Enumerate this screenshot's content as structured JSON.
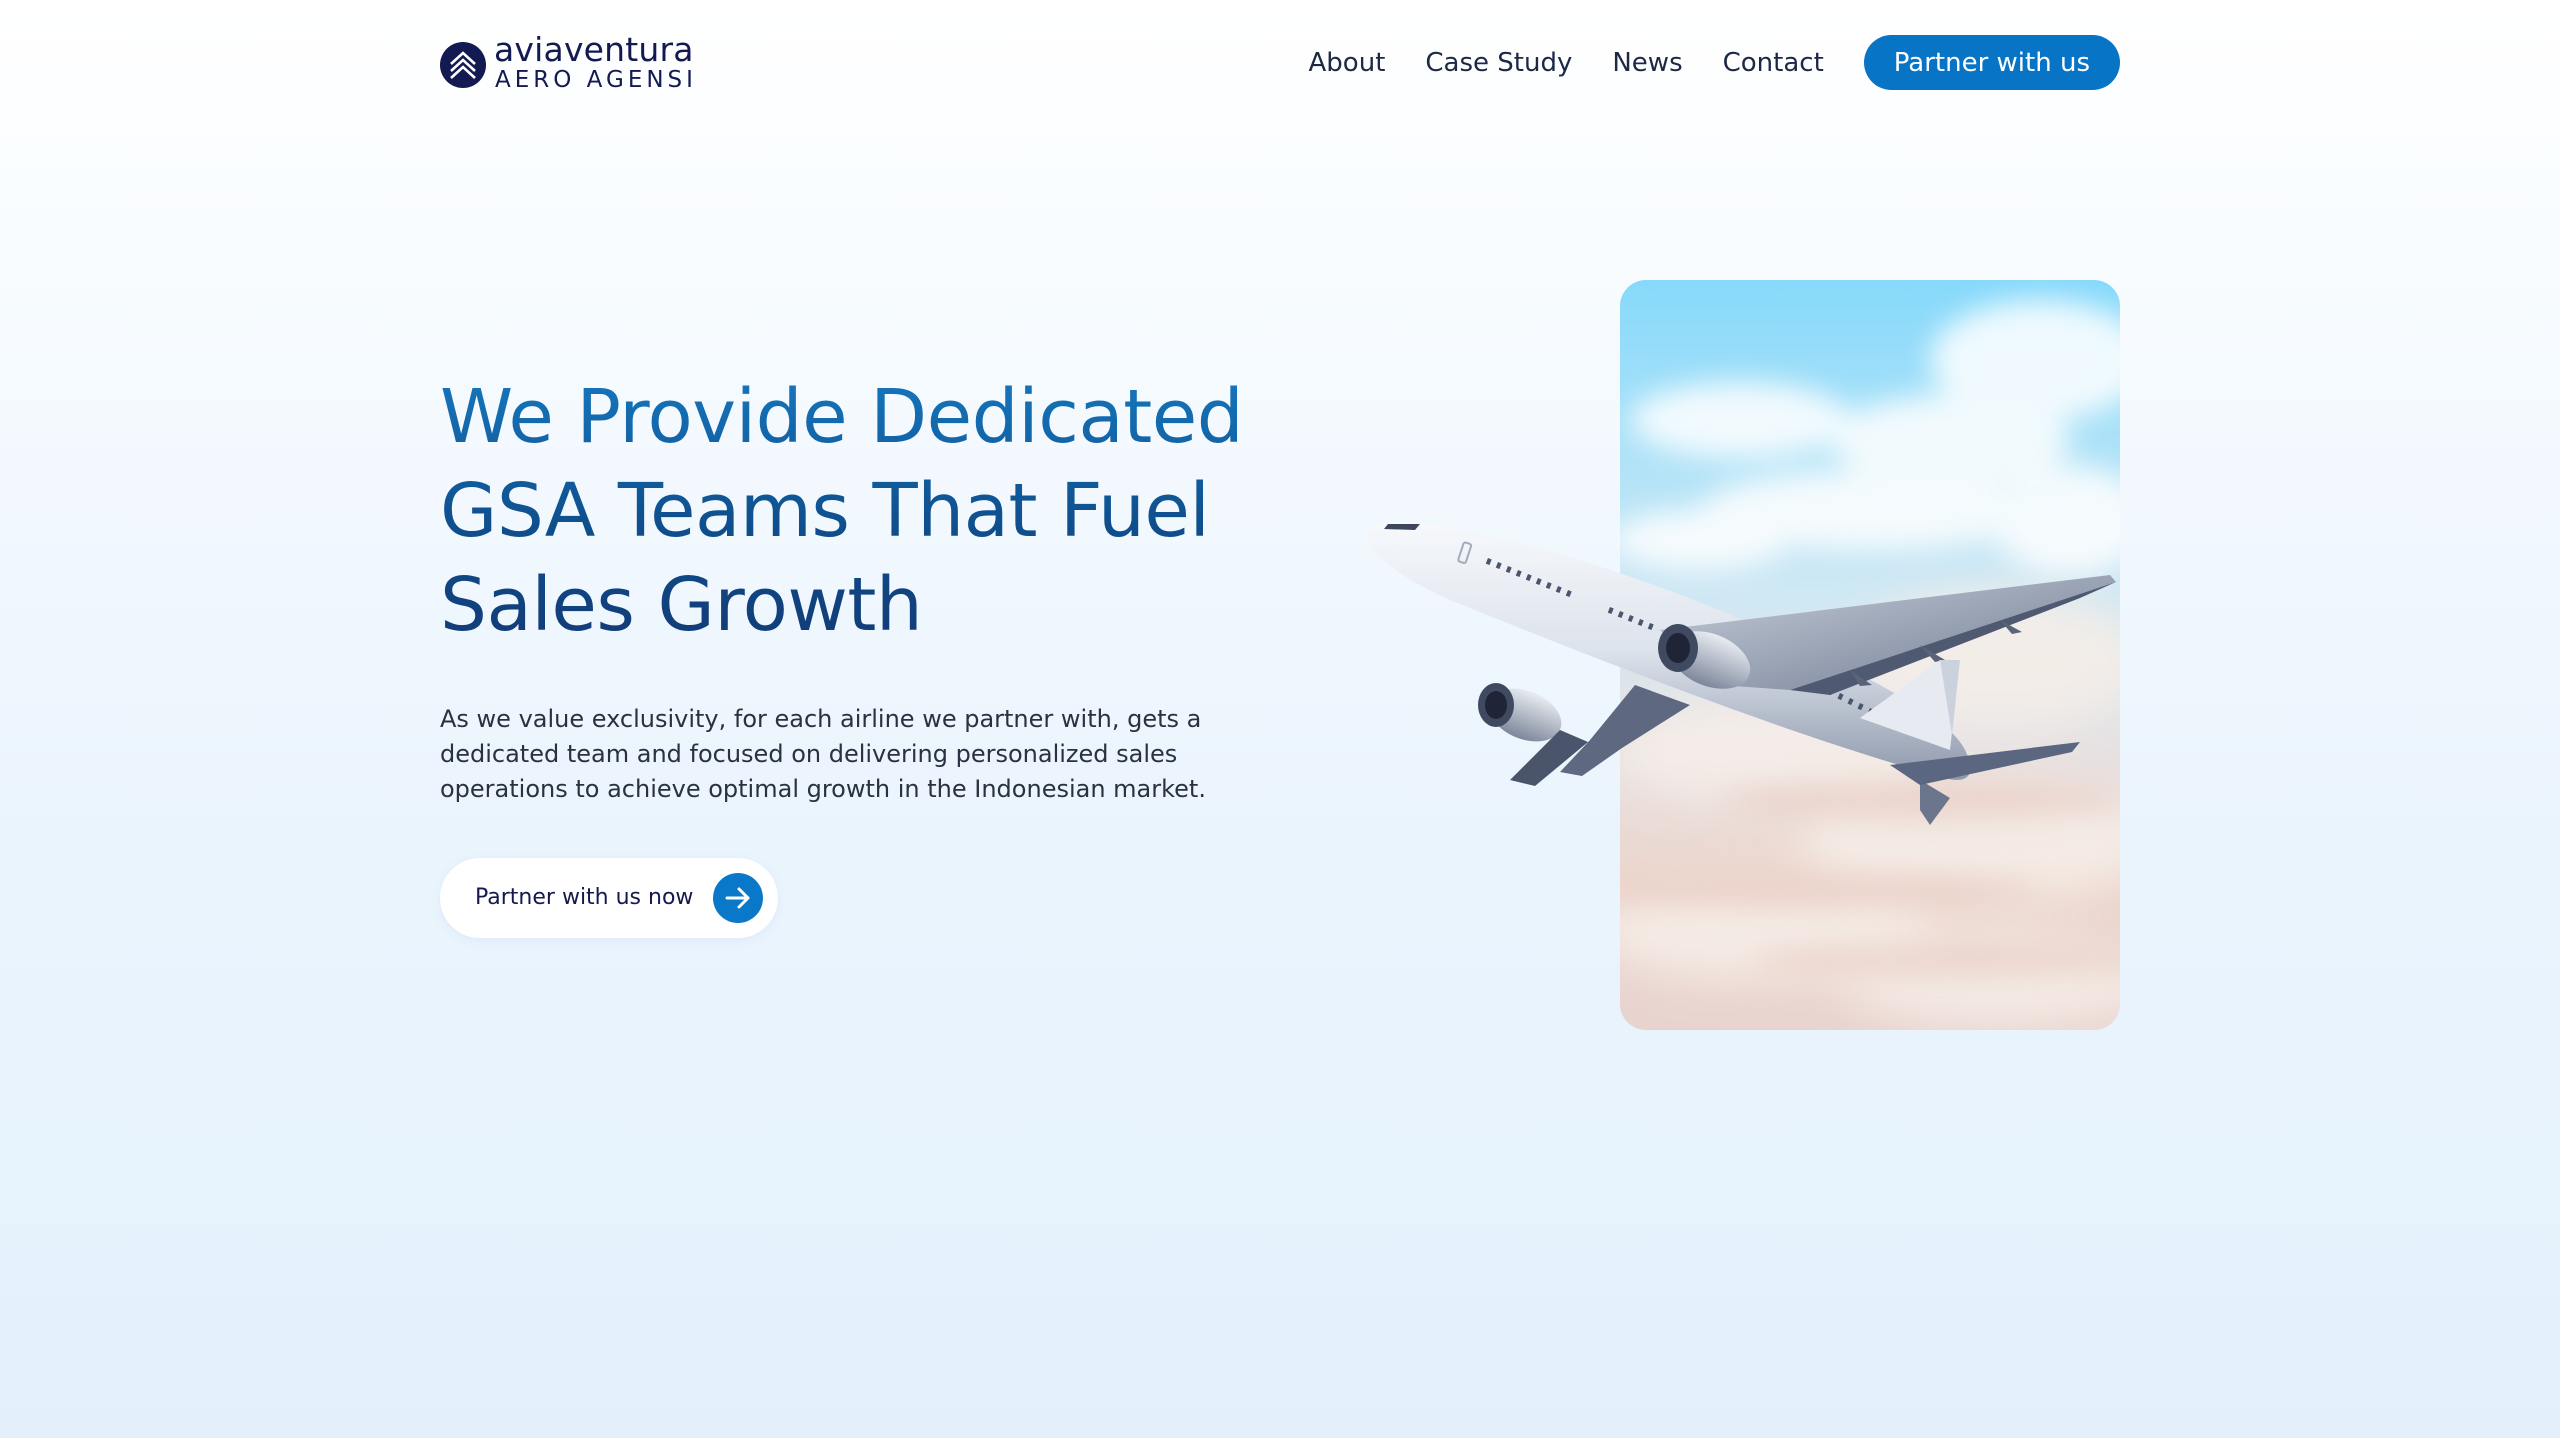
{
  "brand": {
    "name": "aviaventura",
    "subtitle": "AERO AGENSI",
    "logo_icon": "chevron-up-emblem-icon",
    "color": "#131a52"
  },
  "nav": {
    "links": [
      "About",
      "Case Study",
      "News",
      "Contact"
    ],
    "cta_label": "Partner with us"
  },
  "hero": {
    "headline_lines": [
      "We Provide Dedicated",
      "GSA Teams That Fuel",
      "Sales Growth"
    ],
    "description_lines": [
      "As we value exclusivity, for each airline we partner with, gets a",
      "dedicated team and focused on delivering personalized sales",
      "operations to achieve optimal growth in the Indonesian market."
    ],
    "cta_label": "Partner with us now",
    "cta_icon": "arrow-right-icon",
    "image": "airplane-over-clouds"
  },
  "colors": {
    "accent": "#0874c6",
    "headline_top": "#1677be",
    "headline_bottom": "#123a75",
    "text": "#2a3242",
    "background_top": "#ffffff",
    "background_bottom": "#e3f0fc"
  }
}
